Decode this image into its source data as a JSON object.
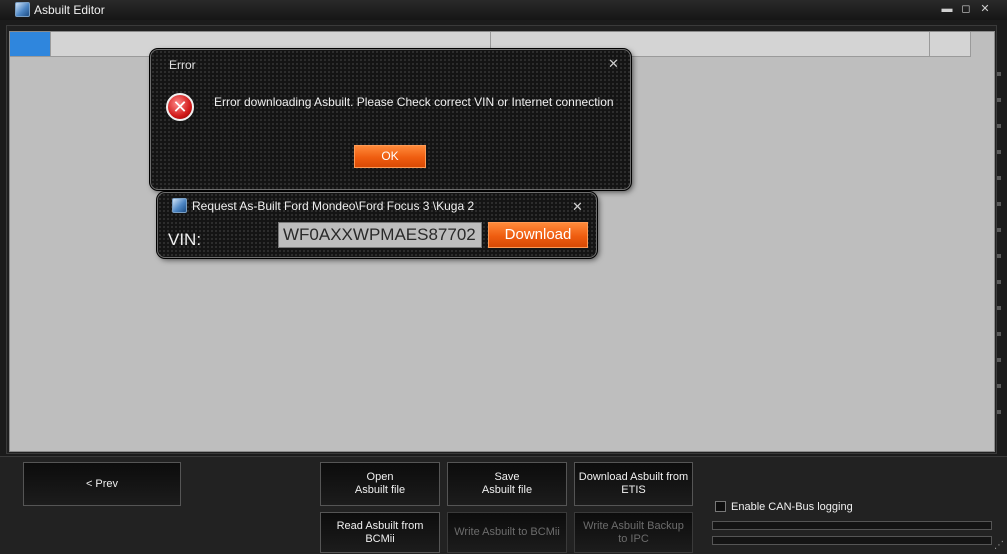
{
  "window": {
    "title": "Asbuilt Editor",
    "minimize_glyph": "▬",
    "maximize_glyph": "◻",
    "close_glyph": "✕"
  },
  "error_dialog": {
    "title": "Error",
    "message": "Error downloading Asbuilt. Please Check correct VIN or Internet connection",
    "ok_label": "OK",
    "close_glyph": "✕",
    "icon": "error-x-icon",
    "icon_glyph": "✕"
  },
  "request_dialog": {
    "title": "Request As-Built Ford Mondeo\\Ford Focus 3 \\Kuga 2",
    "vin_label": "VIN:",
    "vin_value": "WF0AXXWPMAES87702",
    "download_label": "Download",
    "close_glyph": "✕"
  },
  "buttons": {
    "prev": "< Prev",
    "open_line1": "Open",
    "open_line2": "Asbuilt file",
    "save_line1": "Save",
    "save_line2": "Asbuilt file",
    "download_etis_line1": "Download Asbuilt from",
    "download_etis_line2": "ETIS",
    "read_bcmii_line1": "Read Asbuilt from",
    "read_bcmii_line2": "BCMii",
    "write_bcmii": "Write Asbuilt to BCMii",
    "write_ipc_line1": "Write Asbuilt Backup",
    "write_ipc_line2": "to IPC"
  },
  "options": {
    "can_logging_label": "Enable CAN-Bus logging",
    "can_logging_checked": false
  },
  "colors": {
    "accent_orange": "#ef5d10",
    "selection_blue": "#2f86dd",
    "grid_bg": "#bebebe"
  }
}
